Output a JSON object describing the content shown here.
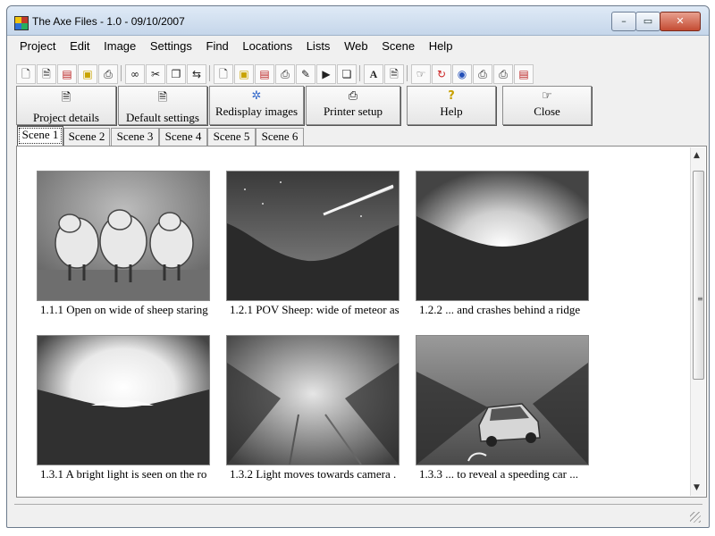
{
  "window": {
    "title": "The Axe Files - 1.0 - 09/10/2007",
    "min": "–",
    "max": "▭",
    "close": "✕"
  },
  "menu": [
    "Project",
    "Edit",
    "Image",
    "Settings",
    "Find",
    "Locations",
    "Lists",
    "Web",
    "Scene",
    "Help"
  ],
  "toolbar_icons": [
    "new-doc-icon",
    "doc-icon",
    "doc-red-icon",
    "folder-icon",
    "print-icon",
    "sep",
    "binoculars-icon",
    "cut-icon",
    "copy-icon",
    "arrows-icon",
    "sep",
    "doc2-icon",
    "folder2-icon",
    "doc-red2-icon",
    "print2-icon",
    "pencil-icon",
    "play-icon",
    "pages-icon",
    "sep",
    "font-icon",
    "doc3-icon",
    "sep",
    "hand-icon",
    "refresh-icon",
    "globe-icon",
    "printer3-icon",
    "printer4-icon",
    "doc-red3-icon"
  ],
  "actions": [
    {
      "label": "Project details",
      "icon": "🗎"
    },
    {
      "label": "Default settings",
      "icon": "🗎"
    },
    {
      "label": "Redisplay images",
      "icon": "✲"
    },
    {
      "label": "Printer setup",
      "icon": "⎙"
    },
    {
      "label": "Help",
      "icon": "?"
    },
    {
      "label": "Close",
      "icon": "☞"
    }
  ],
  "tabs": [
    "Scene 1",
    "Scene 2",
    "Scene 3",
    "Scene 4",
    "Scene 5",
    "Scene 6"
  ],
  "active_tab": "Scene 1",
  "frames": [
    {
      "caption": "1.1.1  Open on wide of sheep staring",
      "scene": "sheep"
    },
    {
      "caption": "1.2.1  POV Sheep: wide of meteor as",
      "scene": "meteor"
    },
    {
      "caption": "1.2.2  ... and crashes behind a ridge",
      "scene": "crash"
    },
    {
      "caption": "1.3.1  A bright light is seen on the ro",
      "scene": "bright"
    },
    {
      "caption": "1.3.2  Light moves towards camera .",
      "scene": "road"
    },
    {
      "caption": "1.3.3  ... to reveal a speeding car ...",
      "scene": "car"
    }
  ],
  "scrollbar_grip": "≡"
}
